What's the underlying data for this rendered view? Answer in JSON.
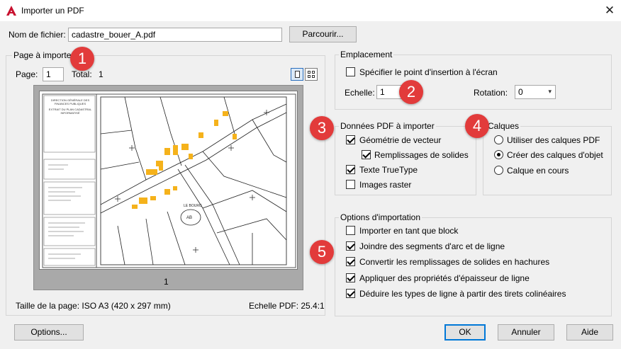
{
  "window": {
    "title": "Importer un PDF",
    "accent_color": "#c8102e"
  },
  "file": {
    "label": "Nom de fichier:",
    "value": "cadastre_bouer_A.pdf",
    "browse_label": "Parcourir..."
  },
  "page_group": {
    "title": "Page à importer",
    "page_label": "Page:",
    "page_value": "1",
    "total_label": "Total:",
    "total_value": "1",
    "preview_caption": "1",
    "page_size_text": "Taille de la page: ISO A3 (420 x 297 mm)",
    "pdf_scale_text": "Echelle PDF: 25.4:1",
    "view_single_icon": "single-page-icon",
    "view_multi_icon": "thumbnail-grid-icon"
  },
  "location": {
    "title": "Emplacement",
    "specify_label": "Spécifier le point d'insertion à l'écran",
    "specify_checked": false,
    "scale_label": "Echelle:",
    "scale_value": "1",
    "rotation_label": "Rotation:",
    "rotation_value": "0"
  },
  "pdf_data": {
    "title": "Données PDF à importer",
    "items": [
      {
        "label": "Géométrie de vecteur",
        "checked": true
      },
      {
        "label": "Remplissages de solides",
        "checked": true
      },
      {
        "label": "Texte TrueType",
        "checked": true
      },
      {
        "label": "Images raster",
        "checked": false
      }
    ]
  },
  "layers": {
    "title": "Calques",
    "options": [
      {
        "label": "Utiliser des calques PDF",
        "selected": false
      },
      {
        "label": "Créer des calques d'objet",
        "selected": true
      },
      {
        "label": "Calque en cours",
        "selected": false
      }
    ]
  },
  "import_options": {
    "title": "Options d'importation",
    "items": [
      {
        "label": "Importer en tant que block",
        "checked": false
      },
      {
        "label": "Joindre des segments d'arc et de ligne",
        "checked": true
      },
      {
        "label": "Convertir les remplissages de solides en hachures",
        "checked": true
      },
      {
        "label": "Appliquer des propriétés d'épaisseur de ligne",
        "checked": true
      },
      {
        "label": "Déduire les types de ligne à partir des tirets colinéaires",
        "checked": true
      }
    ]
  },
  "badges": [
    "1",
    "2",
    "3",
    "4",
    "5"
  ],
  "badge_color": "#e23b3b",
  "buttons": {
    "options": "Options...",
    "ok": "OK",
    "cancel": "Annuler",
    "help": "Aide"
  },
  "preview_text": {
    "header_lines": [
      "DIRECTION GÉNÉRALE DES",
      "FINANCES PUBLIQUES",
      "EXTRAIT DU PLAN CADASTRAL",
      "INFORMATISÉ"
    ],
    "map_label_bourg": "LE BOURG",
    "map_label_ab": "AB"
  }
}
